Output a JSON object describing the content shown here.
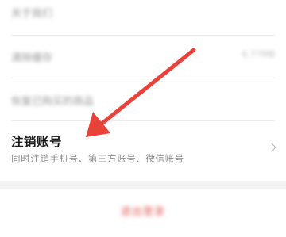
{
  "settings": {
    "rows": [
      {
        "label": "关于我们",
        "value": ""
      },
      {
        "label": "清除缓存",
        "value": "6.77MB"
      },
      {
        "label": "恢复已购买的商品",
        "value": ""
      }
    ],
    "deactivate": {
      "title": "注销账号",
      "subtitle": "同时注销手机号、第三方账号、微信账号"
    },
    "logout_label": "退出登录"
  },
  "annotation": {
    "arrow_color": "#e8423b"
  }
}
